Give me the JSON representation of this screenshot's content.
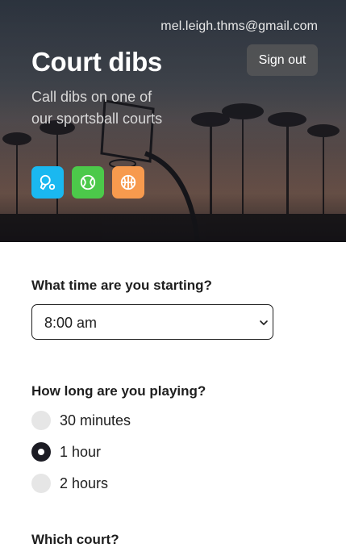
{
  "header": {
    "user_email": "mel.leigh.thms@gmail.com",
    "sign_out_label": "Sign out",
    "title": "Court dibs",
    "tagline": "Call dibs on one of our sportsball courts",
    "background_image": "basketball-hoop-palm-trees-sunset"
  },
  "sports": [
    {
      "icon": "ping-pong-icon",
      "color": "#1ab8f0"
    },
    {
      "icon": "tennis-ball-icon",
      "color": "#4cc94a"
    },
    {
      "icon": "basketball-icon",
      "color": "#f79a4e"
    }
  ],
  "form": {
    "start_time": {
      "label": "What time are you starting?",
      "selected": "8:00 am"
    },
    "duration": {
      "label": "How long are you playing?",
      "options": [
        {
          "label": "30 minutes",
          "checked": false
        },
        {
          "label": "1 hour",
          "checked": true
        },
        {
          "label": "2 hours",
          "checked": false
        }
      ]
    },
    "court": {
      "label": "Which court?"
    }
  }
}
